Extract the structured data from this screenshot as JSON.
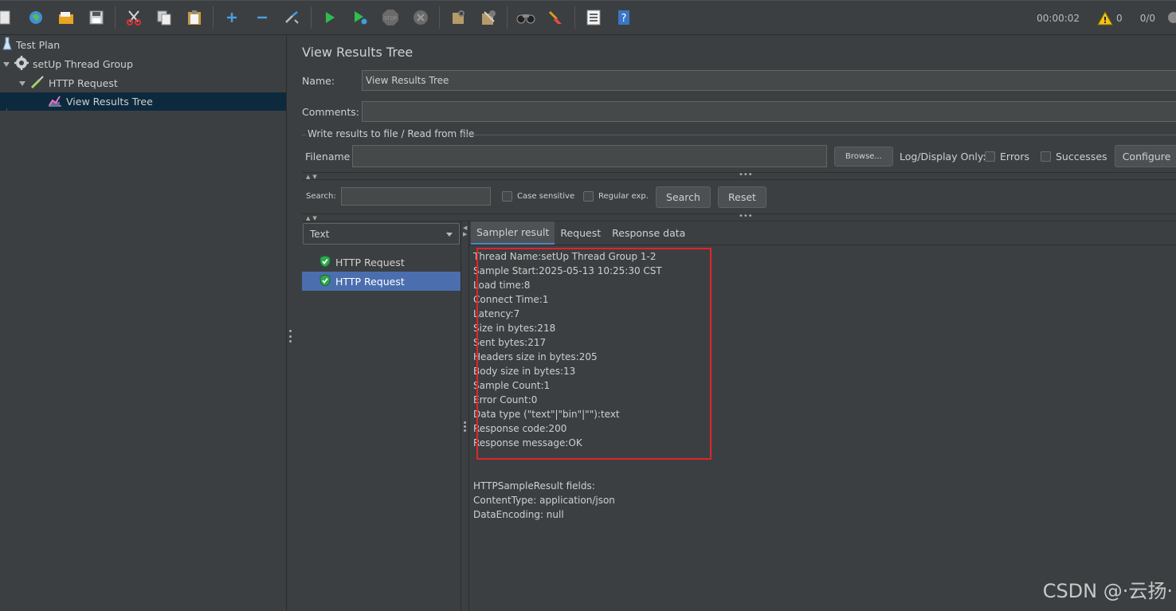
{
  "toolbar": {
    "timer": "00:00:02",
    "warnings": "0",
    "threads": "0/0",
    "icons": [
      "new-icon",
      "templates-icon",
      "open-icon",
      "save-icon",
      "cut-icon",
      "copy-icon",
      "paste-icon",
      "expand-icon",
      "collapse-icon",
      "toggle-icon",
      "start-icon",
      "start-no-pauses-icon",
      "stop-icon",
      "shutdown-icon",
      "clear-icon",
      "clear-all-icon",
      "search-icon",
      "reset-search-icon",
      "function-helper-icon",
      "help-icon"
    ]
  },
  "tree": {
    "items": [
      {
        "label": "Test Plan"
      },
      {
        "label": "setUp Thread Group"
      },
      {
        "label": "HTTP Request"
      },
      {
        "label": "View Results Tree"
      }
    ]
  },
  "panel": {
    "title": "View Results Tree",
    "name_label": "Name:",
    "name_value": "View Results Tree",
    "comments_label": "Comments:",
    "comments_value": "",
    "file_group_title": "Write results to file / Read from file",
    "filename_label": "Filename",
    "filename_value": "",
    "browse_label": "Browse...",
    "log_display_label": "Log/Display Only:",
    "errors_label": "Errors",
    "successes_label": "Successes",
    "configure_label": "Configure"
  },
  "search": {
    "label": "Search:",
    "value": "",
    "case_sensitive_label": "Case sensitive",
    "regex_label": "Regular exp.",
    "search_button": "Search",
    "reset_button": "Reset"
  },
  "results": {
    "renderer": "Text",
    "items": [
      {
        "label": "HTTP Request"
      },
      {
        "label": "HTTP Request"
      }
    ]
  },
  "tabs": [
    "Sampler result",
    "Request",
    "Response data"
  ],
  "sampler_result": {
    "lines": [
      "Thread Name:setUp Thread Group 1-2",
      "Sample Start:2025-05-13 10:25:30 CST",
      "Load time:8",
      "Connect Time:1",
      "Latency:7",
      "Size in bytes:218",
      "Sent bytes:217",
      "Headers size in bytes:205",
      "Body size in bytes:13",
      "Sample Count:1",
      "Error Count:0",
      "Data type (\"text\"|\"bin\"|\"\"):text",
      "Response code:200",
      "Response message:OK"
    ],
    "fields_lines": [
      "HTTPSampleResult fields:",
      "ContentType: application/json",
      "DataEncoding: null"
    ]
  },
  "watermark": "CSDN @·云扬·",
  "colors": {
    "background": "#3c3f41",
    "selected_result": "#4b6eaf",
    "tree_selected": "#0d293e",
    "highlight_box": "#e0242b",
    "success_icon": "#2fa84f"
  }
}
